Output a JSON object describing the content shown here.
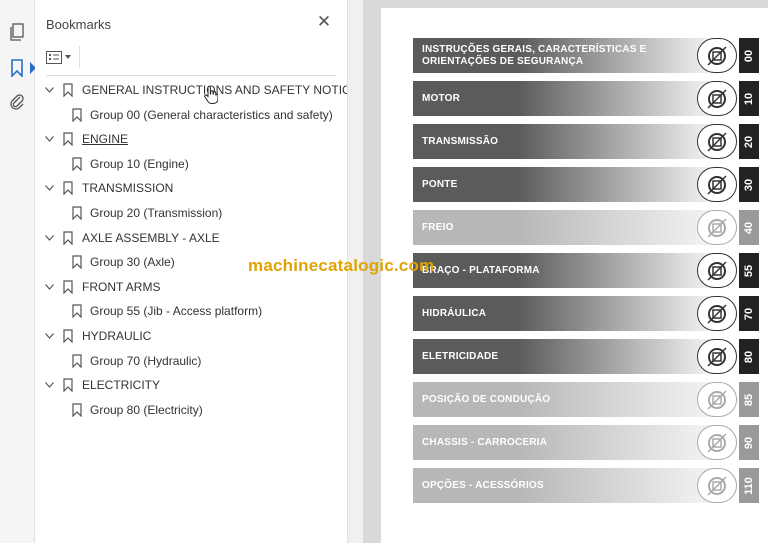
{
  "panel": {
    "title": "Bookmarks",
    "close_icon": "close-icon",
    "options_icon": "list-options-icon"
  },
  "rail": [
    {
      "icon": "pages-icon"
    },
    {
      "icon": "bookmark-icon",
      "active": true
    },
    {
      "icon": "paperclip-icon"
    }
  ],
  "bookmarks": [
    {
      "label": "GENERAL INSTRUCTIONS AND SAFETY NOTICE",
      "level": 0
    },
    {
      "label": "Group 00 (General characteristics and safety)",
      "level": 1
    },
    {
      "label": "ENGINE",
      "level": 0,
      "underlined": true
    },
    {
      "label": "Group 10 (Engine)",
      "level": 1
    },
    {
      "label": "TRANSMISSION",
      "level": 0
    },
    {
      "label": "Group 20 (Transmission)",
      "level": 1
    },
    {
      "label": "AXLE ASSEMBLY - AXLE",
      "level": 0
    },
    {
      "label": "Group 30 (Axle)",
      "level": 1
    },
    {
      "label": "FRONT ARMS",
      "level": 0
    },
    {
      "label": "Group 55 (Jib - Access platform)",
      "level": 1
    },
    {
      "label": "HYDRAULIC",
      "level": 0
    },
    {
      "label": "Group 70  (Hydraulic)",
      "level": 1
    },
    {
      "label": "ELECTRICITY",
      "level": 0
    },
    {
      "label": "Group 80 (Electricity)",
      "level": 1
    }
  ],
  "document": {
    "sections": [
      {
        "label": "INSTRUÇÕES GERAIS, CARACTERÍSTICAS E\nORIENTAÇÕES DE SEGURANÇA",
        "number": "00",
        "shade": "dark",
        "icon": "safety-equipment-icon"
      },
      {
        "label": "MOTOR",
        "number": "10",
        "shade": "dark",
        "icon": "engine-icon"
      },
      {
        "label": "TRANSMISSÃO",
        "number": "20",
        "shade": "dark",
        "icon": "transmission-icon"
      },
      {
        "label": "PONTE",
        "number": "30",
        "shade": "dark",
        "icon": "axle-icon"
      },
      {
        "label": "FREIO",
        "number": "40",
        "shade": "light",
        "icon": "brake-icon"
      },
      {
        "label": "BRAÇO - PLATAFORMA",
        "number": "55",
        "shade": "dark",
        "icon": "jib-icon"
      },
      {
        "label": "HIDRÁULICA",
        "number": "70",
        "shade": "dark",
        "icon": "hydraulic-icon"
      },
      {
        "label": "ELETRICIDADE",
        "number": "80",
        "shade": "dark",
        "icon": "battery-icon"
      },
      {
        "label": "POSIÇÃO DE CONDUÇÃO",
        "number": "85",
        "shade": "light",
        "icon": "driving-seat-icon"
      },
      {
        "label": "CHASSIS - CARROCERIA",
        "number": "90",
        "shade": "light",
        "icon": "chassis-icon"
      },
      {
        "label": "OPÇÕES - ACESSÓRIOS",
        "number": "110",
        "shade": "light",
        "icon": "accessories-icon"
      }
    ]
  },
  "watermark": "machinecatalogic.com",
  "colors": {
    "dark_bar": "#5b5b5b",
    "light_bar": "#b7b7b7",
    "watermark": "#e0a300"
  }
}
